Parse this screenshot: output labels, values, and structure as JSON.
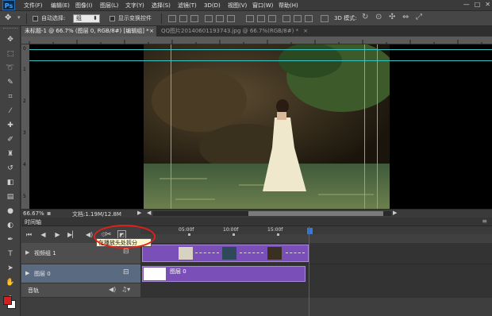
{
  "app": {
    "logo": "Ps"
  },
  "menu": [
    "文件(F)",
    "编辑(E)",
    "图像(I)",
    "图层(L)",
    "文字(Y)",
    "选择(S)",
    "滤镜(T)",
    "3D(D)",
    "视图(V)",
    "窗口(W)",
    "帮助(H)"
  ],
  "window_controls": {
    "minimize": "—",
    "restore": "□",
    "close": "✕"
  },
  "options": {
    "auto_select_label": "自动选择:",
    "auto_select_value": "组",
    "show_transform_label": "显示变换控件",
    "mode_3d_label": "3D 模式:"
  },
  "tabs": [
    {
      "label": "未标题-1 @ 66.7% (图层 0, RGB/8#) [编辑组] *",
      "close": "×"
    },
    {
      "label": "QQ图片20140601193743.jpg @ 66.7%(RGB/8#) *",
      "close": "×"
    }
  ],
  "ruler": {
    "left_ticks": [
      "0",
      "1",
      "2",
      "3",
      "4",
      "5"
    ]
  },
  "status": {
    "zoom": "66.67%",
    "doc": "文档:1.19M/12.8M"
  },
  "timeline": {
    "panel_title": "时间轴",
    "time_labels": [
      "05:00f",
      "10:00f",
      "15:00f"
    ],
    "tooltip": "在播放头处拆分",
    "tracks": [
      {
        "name": "视频组 1"
      },
      {
        "name": "图层 0",
        "clip_label": "图层 0"
      },
      {
        "name": "音轨"
      }
    ]
  },
  "colors": {
    "foreground": "#d42020",
    "background": "#ffffff",
    "guide": "#39c6c6",
    "clip": "#7b4fb8",
    "highlight": "#e0201a"
  }
}
